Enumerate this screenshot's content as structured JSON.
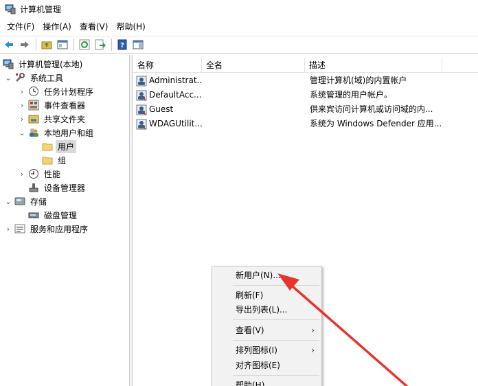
{
  "window": {
    "title": "计算机管理"
  },
  "menubar": [
    "文件(F)",
    "操作(A)",
    "查看(V)",
    "帮助(H)"
  ],
  "toolbar": {
    "buttons": [
      "back-arrow-icon",
      "forward-arrow-icon",
      "up-folder-icon",
      "show-hide-tree-icon",
      "refresh-icon",
      "export-list-icon",
      "help-icon",
      "properties-pane-icon"
    ]
  },
  "tree": {
    "root": "计算机管理(本地)",
    "system_tools": "系统工具",
    "task_scheduler": "任务计划程序",
    "event_viewer": "事件查看器",
    "shared_folders": "共享文件夹",
    "local_users_groups": "本地用户和组",
    "users": "用户",
    "groups": "组",
    "performance": "性能",
    "device_manager": "设备管理器",
    "storage": "存储",
    "disk_management": "磁盘管理",
    "services_apps": "服务和应用程序"
  },
  "list": {
    "columns": [
      "名称",
      "全名",
      "描述"
    ],
    "rows": [
      {
        "name": "Administrat...",
        "fullname": "",
        "description": "管理计算机(域)的内置帐户"
      },
      {
        "name": "DefaultAcc...",
        "fullname": "",
        "description": "系统管理的用户帐户。"
      },
      {
        "name": "Guest",
        "fullname": "",
        "description": "供来宾访问计算机或访问域的内..."
      },
      {
        "name": "WDAGUtilit...",
        "fullname": "",
        "description": "系统为 Windows Defender 应用..."
      }
    ]
  },
  "context_menu": {
    "new_user": "新用户(N)...",
    "refresh": "刷新(F)",
    "export_list": "导出列表(L)...",
    "view": "查看(V)",
    "arrange_icons": "排列图标(I)",
    "line_up_icons": "对齐图标(E)",
    "help": "帮助(H)",
    "submenu_arrow": "›"
  },
  "colors": {
    "annotation_arrow": "#e8352b",
    "selection": "#d9d9d9"
  }
}
